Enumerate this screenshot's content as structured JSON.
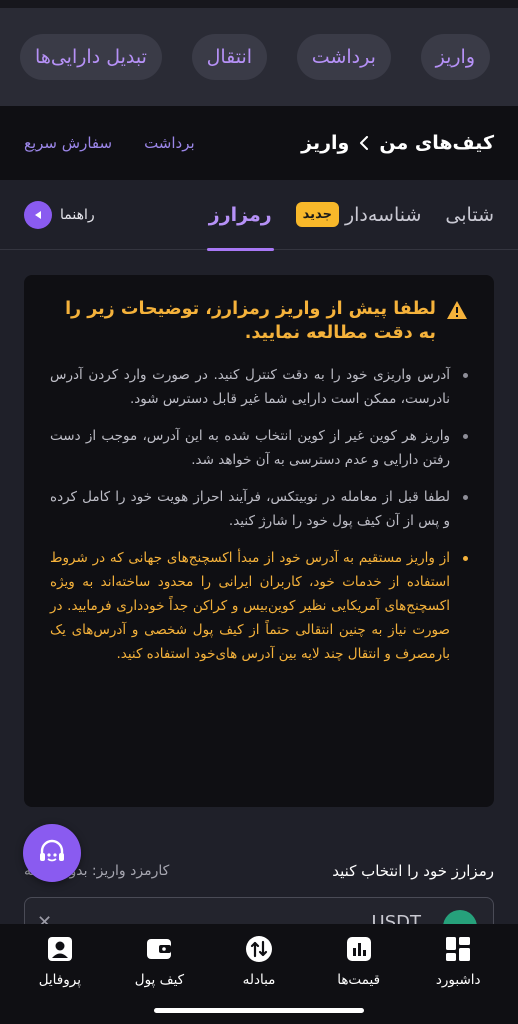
{
  "actions": [
    {
      "label": "واریز"
    },
    {
      "label": "برداشت"
    },
    {
      "label": "انتقال"
    },
    {
      "label": "تبدیل دارایی‌ها"
    }
  ],
  "header": {
    "crumb_parent": "کیف‌های من",
    "crumb_current": "واریز",
    "link_withdraw": "برداشت",
    "link_quick_order": "سفارش سریع"
  },
  "tabs": {
    "instant": "شتابی",
    "tagged": "شناسه‌دار",
    "new_badge": "جدید",
    "crypto": "رمزارز",
    "guide": "راهنما"
  },
  "notice": {
    "title": "لطفا پیش از واریز رمزارز، توضیحات زیر را به دقت مطالعه نمایید.",
    "items": [
      "آدرس واریزی خود را به دقت کنترل کنید. در صورت وارد کردن آدرس نادرست، ممکن است دارایی شما غیر قابل دسترس شود.",
      "واریز هر کوین غیر از کوین انتخاب شده به این آدرس، موجب از دست رفتن دارایی و عدم دسترسی به آن خواهد شد.",
      "لطفا قبل از معامله در نوبیتکس، فرآیند احراز هویت خود را کامل کرده و پس از آن کیف پول خود را شارژ کنید.",
      "از واریز مستقیم به آدرس خود از مبدأ اکسچنج‌های جهانی که در شروط استفاده از خدمات خود، کاربران ایرانی را محدود ساخته‌اند به ویژه اکسچنج‌های آمریکایی نظیر کوین‌بیس و کراکن جداً خودداری فرمایید. در صورت نیاز به چنین انتقالی حتماً از کیف پول شخصی و آدرس‌های یک بارمصرف و انتقال چند لایه بین آدرس های‌خود استفاده کنید."
    ]
  },
  "deposit": {
    "select_label": "رمزارز خود را انتخاب کنید",
    "fee_label": "کارمزد واریز: بدون هزینه",
    "coin_name": "USDT",
    "close_glyph": "✕"
  },
  "bottom_nav": [
    {
      "label": "داشبورد",
      "icon": "dashboard-icon"
    },
    {
      "label": "قیمت‌ها",
      "icon": "chart-icon"
    },
    {
      "label": "مبادله",
      "icon": "exchange-icon"
    },
    {
      "label": "کیف پول",
      "icon": "wallet-icon"
    },
    {
      "label": "پروفایل",
      "icon": "profile-icon"
    }
  ],
  "colors": {
    "accent": "#a878f5",
    "warning": "#f5b23b",
    "badge": "#f8b82a",
    "background": "#1f2029",
    "panel": "#0f0f13"
  }
}
